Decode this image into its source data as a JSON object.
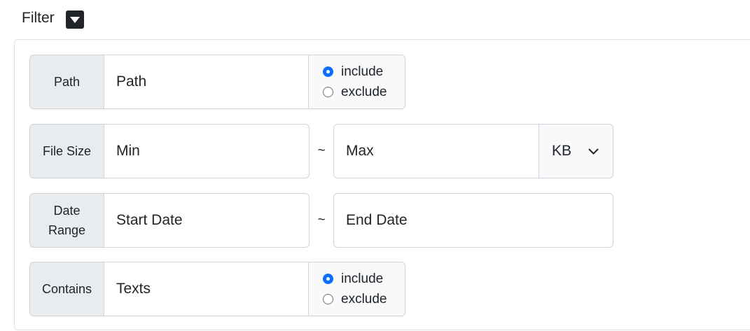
{
  "filter": {
    "title": "Filter",
    "toggle_icon": "caret-down-icon"
  },
  "path_row": {
    "label": "Path",
    "placeholder": "Path",
    "options": [
      "include",
      "exclude"
    ],
    "selected": "include"
  },
  "size_row": {
    "label": "File Size",
    "min_placeholder": "Min",
    "separator": "~",
    "max_placeholder": "Max",
    "unit": "KB",
    "unit_icon": "chevron-down-icon"
  },
  "date_row": {
    "label_line1": "Date",
    "label_line2": "Range",
    "start_placeholder": "Start Date",
    "separator": "~",
    "end_placeholder": "End Date"
  },
  "contains_row": {
    "label": "Contains",
    "placeholder": "Texts",
    "options": [
      "include",
      "exclude"
    ],
    "selected": "include"
  },
  "colors": {
    "accent": "#0d6efd",
    "label_bg": "#e9ecef",
    "border": "#ced4da"
  }
}
